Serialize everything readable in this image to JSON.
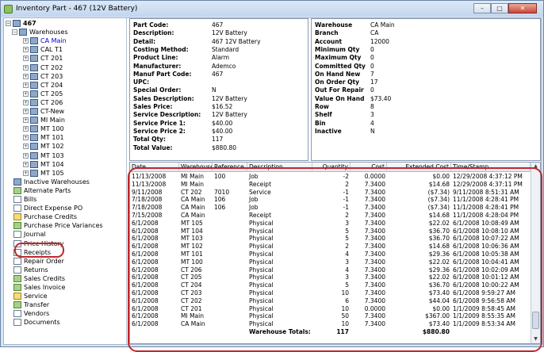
{
  "window": {
    "title": "Inventory Part - 467 (12V Battery)"
  },
  "tree": {
    "root": "467",
    "warehouses_label": "Warehouses",
    "warehouses": [
      "CA Main",
      "CAL T1",
      "CT 201",
      "CT 202",
      "CT 203",
      "CT 204",
      "CT 205",
      "CT 206",
      "CT-New",
      "MI Main",
      "MT 100",
      "MT 101",
      "MT 102",
      "MT 103",
      "MT 104",
      "MT 105"
    ],
    "nodes": [
      "Inactive Warehouses",
      "Alternate Parts",
      "Bills",
      "Direct Expense PO",
      "Purchase Credits",
      "Purchase Price Variances",
      "Journal",
      "Price History",
      "Receipts",
      "Repair Order",
      "Returns",
      "Sales Credits",
      "Sales Invoice",
      "Service",
      "Transfer",
      "Vendors",
      "Documents"
    ]
  },
  "part_info": {
    "labels": [
      "Part Code:",
      "Description:",
      "Detail:",
      "Costing Method:",
      "Product Line:",
      "Manufacturer:",
      "Manuf Part Code:",
      "UPC:",
      "Special Order:",
      "Sales Description:",
      "Sales Price:",
      "Service Description:",
      "Service Price 1:",
      "Service Price 2:",
      "Total Qty:",
      "Total Value:"
    ],
    "values": [
      "467",
      "12V Battery",
      "467 12V Battery",
      "Standard",
      "Alarm",
      "Ademco",
      "467",
      "",
      "N",
      "12V Battery",
      "$16.52",
      "12V Battery",
      "$40.00",
      "$40.00",
      "117",
      "$880.80"
    ]
  },
  "warehouse_info": {
    "labels": [
      "Warehouse",
      "Branch",
      "Account",
      "Minimum Qty",
      "Maximum Qty",
      "Committed Qty",
      "On Hand New",
      "On Order Qty",
      "Out For Repair",
      "Value On Hand",
      "Row",
      "Shelf",
      "Bin",
      "Inactive"
    ],
    "values": [
      "CA Main",
      "CA",
      "12000",
      "0",
      "0",
      "0",
      "7",
      "17",
      "0",
      "$73.40",
      "8",
      "3",
      "4",
      "N"
    ]
  },
  "journal": {
    "columns": [
      "Date",
      "Warehouse",
      "Reference",
      "Description",
      "Quantity",
      "Cost",
      "Extended Cost",
      "Time/Stamp"
    ],
    "rows": [
      [
        "11/13/2008",
        "MI Main",
        "100",
        "Job",
        "-2",
        "0.0000",
        "$0.00",
        "12/29/2008 4:37:12 PM"
      ],
      [
        "11/13/2008",
        "MI Main",
        "",
        "Receipt",
        "2",
        "7.3400",
        "$14.68",
        "12/29/2008 4:37:11 PM"
      ],
      [
        "9/11/2008",
        "CT 202",
        "7010",
        "Service",
        "-1",
        "7.3400",
        "($7.34)",
        "9/11/2008 8:51:31 AM"
      ],
      [
        "7/18/2008",
        "CA Main",
        "106",
        "Job",
        "-1",
        "7.3400",
        "($7.34)",
        "11/1/2008 4:28:41 PM"
      ],
      [
        "7/18/2008",
        "CA Main",
        "106",
        "Job",
        "-1",
        "7.3400",
        "($7.34)",
        "11/1/2008 4:28:41 PM"
      ],
      [
        "7/15/2008",
        "CA Main",
        "",
        "Receipt",
        "2",
        "7.3400",
        "$14.68",
        "11/1/2008 4:28:04 PM"
      ],
      [
        "6/1/2008",
        "MT 105",
        "",
        "Physical",
        "3",
        "7.3400",
        "$22.02",
        "6/1/2008 10:08:49 AM"
      ],
      [
        "6/1/2008",
        "MT 104",
        "",
        "Physical",
        "5",
        "7.3400",
        "$36.70",
        "6/1/2008 10:08:10 AM"
      ],
      [
        "6/1/2008",
        "MT 103",
        "",
        "Physical",
        "5",
        "7.3400",
        "$36.70",
        "6/1/2008 10:07:22 AM"
      ],
      [
        "6/1/2008",
        "MT 102",
        "",
        "Physical",
        "2",
        "7.3400",
        "$14.68",
        "6/1/2008 10:06:36 AM"
      ],
      [
        "6/1/2008",
        "MT 101",
        "",
        "Physical",
        "4",
        "7.3400",
        "$29.36",
        "6/1/2008 10:05:38 AM"
      ],
      [
        "6/1/2008",
        "MT 100",
        "",
        "Physical",
        "3",
        "7.3400",
        "$22.02",
        "6/1/2008 10:04:41 AM"
      ],
      [
        "6/1/2008",
        "CT 206",
        "",
        "Physical",
        "4",
        "7.3400",
        "$29.36",
        "6/1/2008 10:02:09 AM"
      ],
      [
        "6/1/2008",
        "CT 205",
        "",
        "Physical",
        "3",
        "7.3400",
        "$22.02",
        "6/1/2008 10:01:12 AM"
      ],
      [
        "6/1/2008",
        "CT 204",
        "",
        "Physical",
        "5",
        "7.3400",
        "$36.70",
        "6/1/2008 10:00:22 AM"
      ],
      [
        "6/1/2008",
        "CT 203",
        "",
        "Physical",
        "10",
        "7.3400",
        "$73.40",
        "6/1/2008 9:59:27 AM"
      ],
      [
        "6/1/2008",
        "CT 202",
        "",
        "Physical",
        "6",
        "7.3400",
        "$44.04",
        "6/1/2008 9:56:58 AM"
      ],
      [
        "6/1/2008",
        "CT 201",
        "",
        "Physical",
        "10",
        "0.0000",
        "$0.00",
        "1/1/2009 8:58:45 AM"
      ],
      [
        "6/1/2008",
        "MI Main",
        "",
        "Physical",
        "50",
        "7.3400",
        "$367.00",
        "1/1/2009 8:55:35 AM"
      ],
      [
        "6/1/2008",
        "CA Main",
        "",
        "Physical",
        "10",
        "7.3400",
        "$73.40",
        "1/1/2009 8:53:34 AM"
      ]
    ],
    "totals_label": "Warehouse Totals:",
    "totals_qty": "117",
    "totals_ext": "$880.80"
  },
  "colors": {
    "highlight_ring": "#c0272d",
    "selected_text": "#0000cc"
  }
}
